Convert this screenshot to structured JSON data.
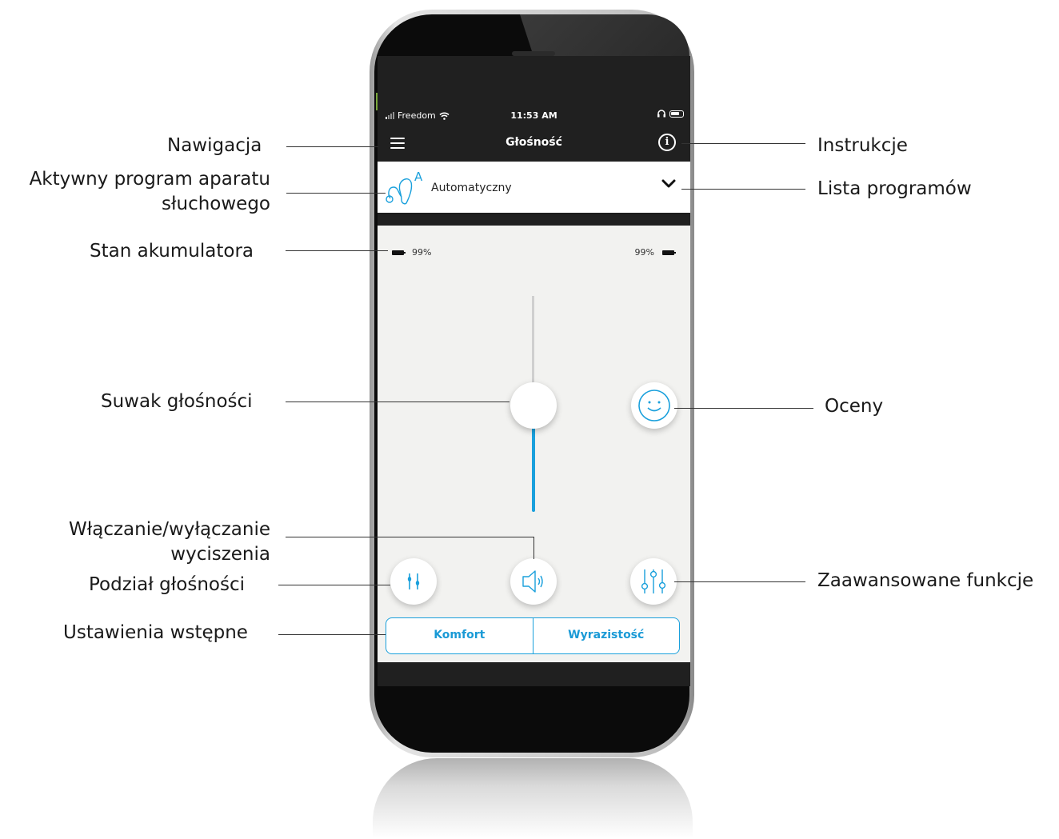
{
  "status_bar": {
    "carrier": "Freedom",
    "time": "11:53 AM"
  },
  "nav": {
    "title": "Głośność"
  },
  "program": {
    "name": "Automatyczny",
    "badge": "A"
  },
  "battery": {
    "left_label": "99%",
    "right_label": "99%",
    "left_level": 0.99,
    "right_level": 0.99
  },
  "volume": {
    "level": 0.5
  },
  "presets": {
    "option_1": "Komfort",
    "option_2": "Wyrazistość"
  },
  "callouts": {
    "navigation": "Nawigacja",
    "active_program_line1": "Aktywny program aparatu",
    "active_program_line2": "słuchowego",
    "battery_state": "Stan akumulatora",
    "volume_slider": "Suwak głośności",
    "mute_line1": "Włączanie/wyłączanie",
    "mute_line2": "wyciszenia",
    "volume_split": "Podział głośności",
    "presets": "Ustawienia wstępne",
    "instructions": "Instrukcje",
    "program_list": "Lista programów",
    "ratings": "Oceny",
    "advanced": "Zaawansowane funkcje"
  },
  "colors": {
    "accent": "#1aa0dc",
    "nav_background": "#202020",
    "content_background": "#f2f2f0"
  },
  "icons": [
    "wifi-icon",
    "headphones-icon",
    "hamburger-icon",
    "info-icon",
    "hearing-aid-icon",
    "chevron-down-icon",
    "battery-icon",
    "smiley-icon",
    "equalizer-icon",
    "speaker-icon",
    "sliders-icon"
  ]
}
